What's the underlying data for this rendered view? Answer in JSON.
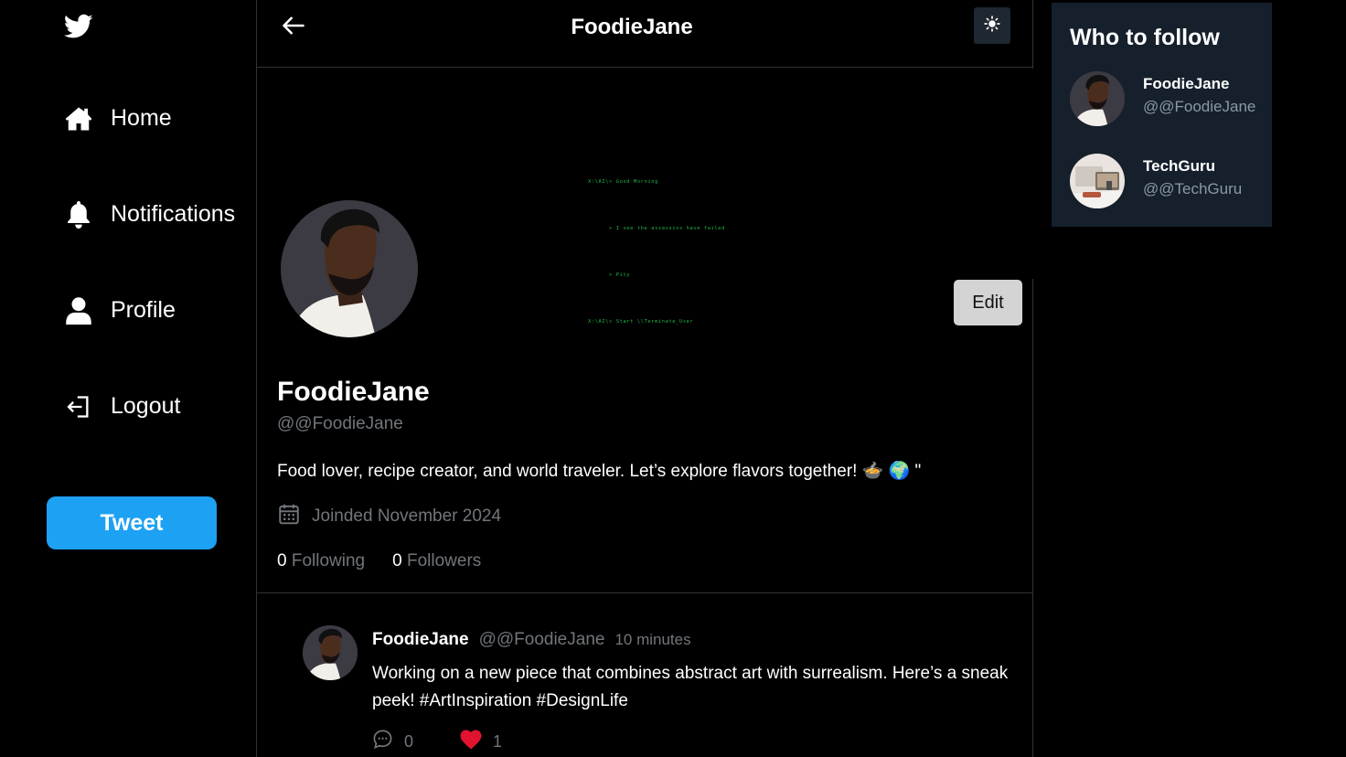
{
  "colors": {
    "accent": "#1da1f2",
    "background": "#000000",
    "card": "#16202c",
    "muted": "#71767b",
    "like": "#f91880",
    "terminal_green": "#1fb64a"
  },
  "sidebar": {
    "logo_icon": "twitter-bird-icon",
    "items": [
      {
        "label": "Home",
        "icon": "home-icon"
      },
      {
        "label": "Notifications",
        "icon": "bell-icon"
      },
      {
        "label": "Profile",
        "icon": "user-icon"
      },
      {
        "label": "Logout",
        "icon": "logout-icon"
      }
    ],
    "tweet_button": "Tweet"
  },
  "header": {
    "title": "FoodieJane",
    "back_icon": "arrow-left-icon",
    "theme_icon": "sun-icon"
  },
  "banner": {
    "terminal_lines": [
      "X:\\AI\\> Good Morning",
      "      > I see the assassins have failed",
      "      > Pity",
      "X:\\AI\\> Start \\\\Terminate_User"
    ]
  },
  "profile": {
    "name": "FoodieJane",
    "handle": "@@FoodieJane",
    "bio": "Food lover, recipe creator, and world traveler. Let’s explore flavors together! 🍲 🌍 \"",
    "joined": "Joinded November 2024",
    "following_count": "0",
    "following_label": "Following",
    "followers_count": "0",
    "followers_label": "Followers",
    "edit_button": "Edit"
  },
  "tweets": [
    {
      "name": "FoodieJane",
      "handle": "@@FoodieJane",
      "time": "10 minutes",
      "text": "Working on a new piece that combines abstract art with surrealism. Here’s a sneak peek! #ArtInspiration #DesignLife",
      "comments": "0",
      "likes": "1"
    }
  ],
  "who_to_follow": {
    "title": "Who to follow",
    "users": [
      {
        "name": "FoodieJane",
        "handle": "@@FoodieJane"
      },
      {
        "name": "TechGuru",
        "handle": "@@TechGuru"
      }
    ]
  }
}
